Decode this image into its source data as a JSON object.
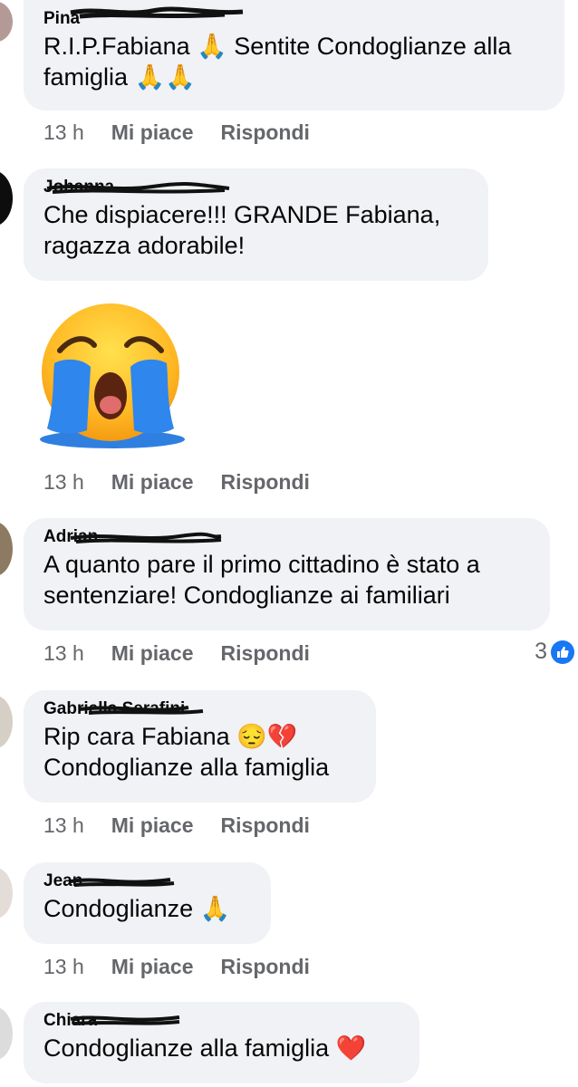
{
  "comments": [
    {
      "author": "Pina",
      "text": "R.I.P.Fabiana 🙏 Sentite Condoglianze alla famiglia 🙏🙏",
      "time": "13 h",
      "like": "Mi piace",
      "reply": "Rispondi"
    },
    {
      "author": "Johanna",
      "text": "Che dispiacere!!! GRANDE Fabiana, ragazza adorabile!",
      "time": "13 h",
      "like": "Mi piace",
      "reply": "Rispondi",
      "sticker": "crying-face-sticker"
    },
    {
      "author": "Adrian",
      "text": "A quanto pare il primo cittadino è stato a sentenziare! Condoglianze ai familiari",
      "time": "13 h",
      "like": "Mi piace",
      "reply": "Rispondi",
      "reactions": {
        "count": "3",
        "icon": "like-icon"
      }
    },
    {
      "author": "Gabriella Serafini",
      "text": "Rip cara Fabiana 😔💔 Condoglianze alla famiglia",
      "time": "13 h",
      "like": "Mi piace",
      "reply": "Rispondi"
    },
    {
      "author": "Jean",
      "text": "Condoglianze 🙏",
      "time": "13 h",
      "like": "Mi piace",
      "reply": "Rispondi"
    },
    {
      "author": "Chiara",
      "text": "Condoglianze alla famiglia ❤️",
      "time": "",
      "like": "",
      "reply": ""
    }
  ],
  "colors": {
    "bubble": "#f0f2f5",
    "meta": "#65676b",
    "like_blue": "#1877f2"
  }
}
